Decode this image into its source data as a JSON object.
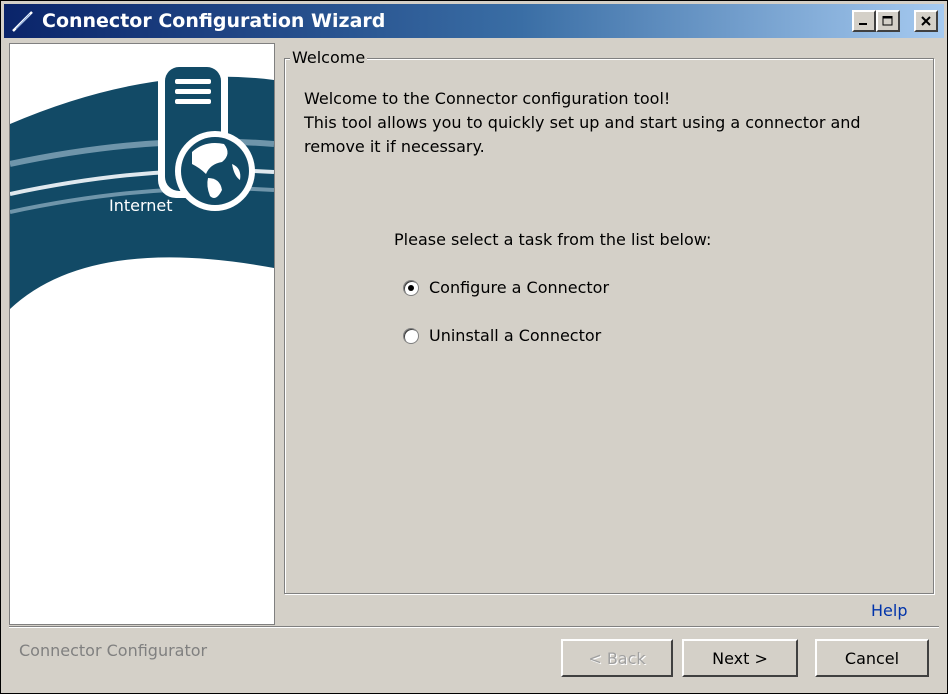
{
  "window": {
    "title": "Connector Configuration Wizard",
    "minimize_icon": "minimize-icon",
    "maximize_icon": "maximize-icon",
    "close_icon": "close-icon"
  },
  "sidebar": {
    "graphic_label": "Internet",
    "icons": [
      "server-icon",
      "globe-icon"
    ]
  },
  "welcome": {
    "legend": "Welcome",
    "lines": [
      "Welcome to the Connector configuration tool!",
      "This tool allows you to quickly set up and start using a connector and",
      "remove it if necessary."
    ],
    "prompt": "Please select a task from the list below:",
    "options": [
      {
        "label": "Configure a Connector",
        "selected": true
      },
      {
        "label": "Uninstall a Connector",
        "selected": false
      }
    ]
  },
  "help_label": "Help",
  "footer": {
    "label": "Connector Configurator",
    "back_label": "< Back",
    "next_label": "Next >",
    "cancel_label": "Cancel"
  },
  "colors": {
    "title_gradient_start": "#0a246a",
    "title_gradient_end": "#a6caf0",
    "sidebar_accent": "#124a66",
    "link": "#0033aa"
  }
}
